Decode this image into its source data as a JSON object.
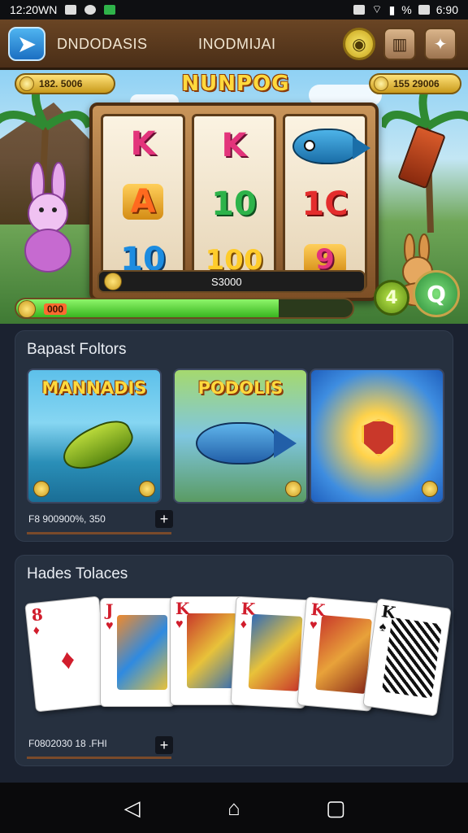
{
  "status_bar": {
    "time_left": "12:20WN",
    "battery": "%",
    "time_right": "6:90"
  },
  "header": {
    "app_title": "DNDODASIS",
    "center_title": "INODMIJAI",
    "back_icon": "back-arrow-icon",
    "coin_icon": "coin-icon",
    "book_icon": "book-icon",
    "star_icon": "star-icon"
  },
  "game": {
    "title": "NUNPOG",
    "balance_left": "182. 5006",
    "balance_right": "155 29006",
    "reels": [
      [
        "K",
        "A",
        "10"
      ],
      [
        "K",
        "10",
        "100"
      ],
      [
        "fish",
        "1C",
        "9"
      ]
    ],
    "win_value": "S3000",
    "progress_label": "000",
    "progress_fraction": 0.78,
    "button_small": "4",
    "button_large": "Q"
  },
  "features": {
    "title": "Bapast Foltors",
    "cards": [
      {
        "name": "MANNADIS"
      },
      {
        "name": "PODOLIS"
      },
      {
        "name": ""
      }
    ],
    "meta_text": "F8 900900%, 350",
    "plus_label": "+"
  },
  "hand": {
    "title": "Hades Tolaces",
    "cards": [
      {
        "rank": "8",
        "suit": "♦",
        "color": "red"
      },
      {
        "rank": "J",
        "suit": "♥",
        "color": "red"
      },
      {
        "rank": "K",
        "suit": "♥",
        "color": "red"
      },
      {
        "rank": "K",
        "suit": "♦",
        "color": "red"
      },
      {
        "rank": "K",
        "suit": "♥",
        "color": "red"
      },
      {
        "rank": "K",
        "suit": "♠",
        "color": "black"
      }
    ],
    "meta_text": "F0802030 18 .FHI",
    "plus_label": "+"
  },
  "nav": {
    "back": "◁",
    "home": "⌂",
    "recents": "▢"
  }
}
